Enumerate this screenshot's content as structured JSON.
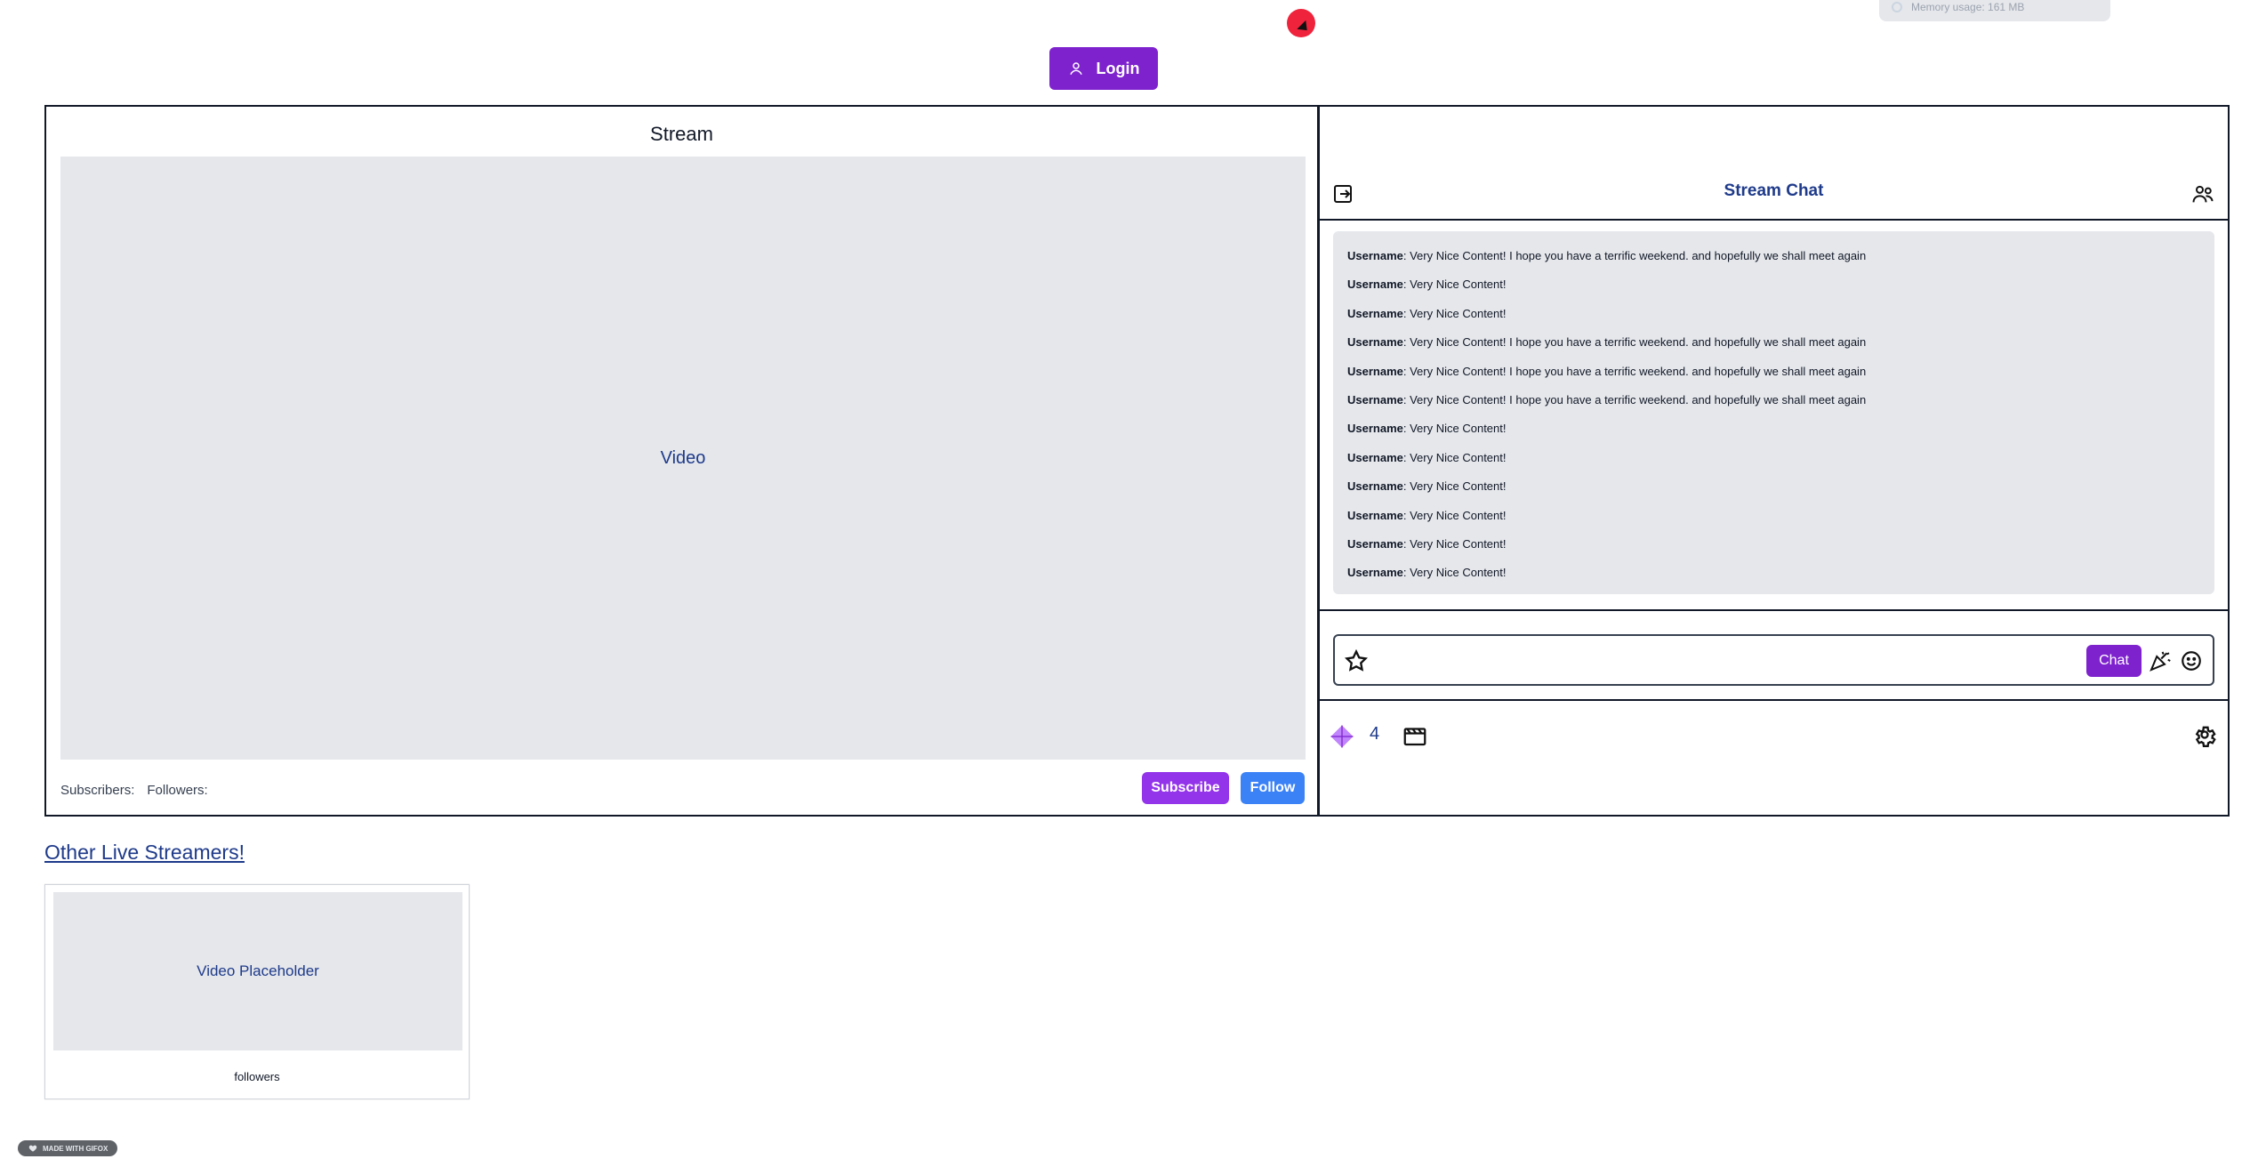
{
  "top": {
    "login_label": "Login",
    "memory_text": "Memory usage: 161 MB"
  },
  "stream": {
    "title": "Stream",
    "video_label": "Video",
    "subscribers_label": "Subscribers:",
    "followers_label": "Followers:",
    "subscribe_label": "Subscribe",
    "follow_label": "Follow"
  },
  "chat": {
    "title": "Stream Chat",
    "messages": [
      {
        "user": "Username",
        "text": ": Very Nice Content! I hope you have a terrific weekend. and hopefully we shall meet again"
      },
      {
        "user": "Username",
        "text": ": Very Nice Content!"
      },
      {
        "user": "Username",
        "text": ": Very Nice Content!"
      },
      {
        "user": "Username",
        "text": ": Very Nice Content! I hope you have a terrific weekend. and hopefully we shall meet again"
      },
      {
        "user": "Username",
        "text": ": Very Nice Content! I hope you have a terrific weekend. and hopefully we shall meet again"
      },
      {
        "user": "Username",
        "text": ": Very Nice Content! I hope you have a terrific weekend. and hopefully we shall meet again"
      },
      {
        "user": "Username",
        "text": ": Very Nice Content!"
      },
      {
        "user": "Username",
        "text": ": Very Nice Content!"
      },
      {
        "user": "Username",
        "text": ": Very Nice Content!"
      },
      {
        "user": "Username",
        "text": ": Very Nice Content!"
      },
      {
        "user": "Username",
        "text": ": Very Nice Content!"
      },
      {
        "user": "Username",
        "text": ": Very Nice Content!"
      }
    ],
    "input_value": "",
    "input_placeholder": "",
    "chat_button_label": "Chat",
    "gem_count": "4"
  },
  "others": {
    "link_label": "Other Live Streamers!",
    "cards": [
      {
        "video_label": "Video Placeholder",
        "footer": "followers"
      }
    ]
  },
  "badge": {
    "text": "MADE WITH GIFOX"
  },
  "colors": {
    "accent_purple": "#7e22ce",
    "follow_blue": "#3b82f6",
    "text_navy": "#1e3a8a",
    "panel_gray": "#e5e7eb"
  },
  "icons": {
    "login": "user-icon",
    "exit": "exit-icon",
    "users": "users-icon",
    "star": "star-icon",
    "party": "party-popper-icon",
    "emoji": "emoji-smile-icon",
    "gem": "gem-icon",
    "clapper": "clapperboard-icon",
    "settings": "gear-icon"
  }
}
